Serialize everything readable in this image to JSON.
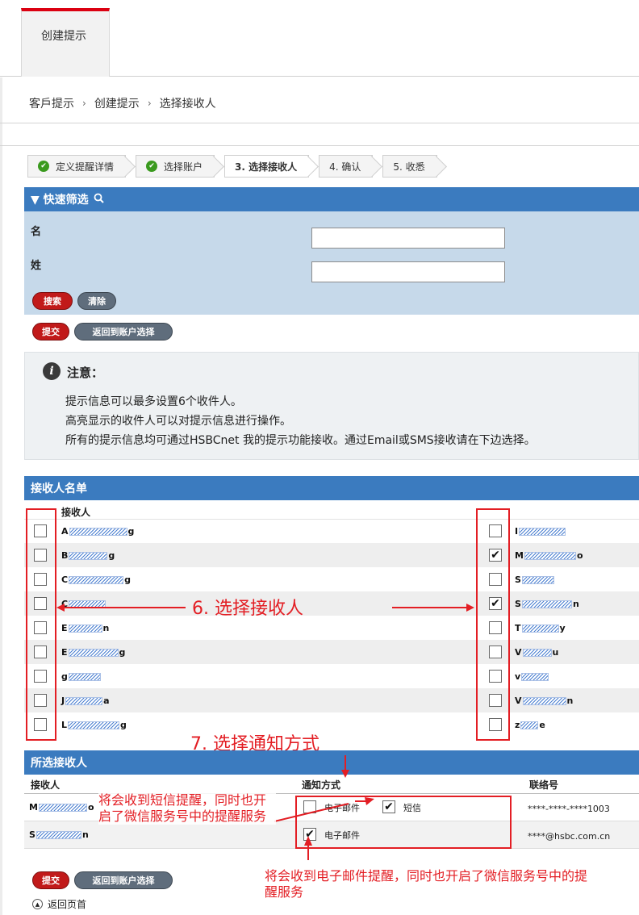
{
  "tab": {
    "label": "创建提示"
  },
  "breadcrumb": {
    "items": [
      "客戶提示",
      "创建提示",
      "选择接收人"
    ],
    "separator": "›"
  },
  "steps": [
    {
      "label": "定义提醒详情",
      "done": true
    },
    {
      "label": "选择账户",
      "done": true
    },
    {
      "label": "3. 选择接收人",
      "done": false,
      "active": true
    },
    {
      "label": "4. 确认",
      "done": false
    },
    {
      "label": "5. 收悉",
      "done": false
    }
  ],
  "quick_filter": {
    "title": "▼ 快速筛选",
    "first_name_label": "名",
    "last_name_label": "姓",
    "first_name_value": "",
    "last_name_value": "",
    "search_button": "搜索",
    "clear_button": "清除"
  },
  "actions": {
    "submit": "提交",
    "back_to_accounts": "返回到账户选择"
  },
  "notice": {
    "title": "注意：",
    "lines": [
      "提示信息可以最多设置6个收件人。",
      "高亮显示的收件人可以对提示信息进行操作。",
      "所有的提示信息均可通过HSBCnet 我的提示功能接收。通过Email或SMS接收请在下边选择。"
    ]
  },
  "recipients": {
    "title": "接收人名单",
    "column": "接收人",
    "left": [
      {
        "initial": "A",
        "tail": "g",
        "checked": false
      },
      {
        "initial": "B",
        "tail": "g",
        "checked": false
      },
      {
        "initial": "C",
        "tail": "g",
        "checked": false
      },
      {
        "initial": "C",
        "tail": "",
        "checked": false
      },
      {
        "initial": "E",
        "tail": "n",
        "checked": false
      },
      {
        "initial": "E",
        "tail": "g",
        "checked": false
      },
      {
        "initial": "g",
        "tail": "",
        "checked": false
      },
      {
        "initial": "J",
        "tail": "a",
        "checked": false
      },
      {
        "initial": "L",
        "tail": "g",
        "checked": false
      }
    ],
    "right": [
      {
        "initial": "I",
        "tail": "",
        "checked": false
      },
      {
        "initial": "M",
        "tail": "o",
        "checked": true
      },
      {
        "initial": "S",
        "tail": "",
        "checked": false
      },
      {
        "initial": "S",
        "tail": "n",
        "checked": true
      },
      {
        "initial": "T",
        "tail": "y",
        "checked": false
      },
      {
        "initial": "V",
        "tail": "u",
        "checked": false
      },
      {
        "initial": "v",
        "tail": "",
        "checked": false
      },
      {
        "initial": "V",
        "tail": "n",
        "checked": false
      },
      {
        "initial": "z",
        "tail": "e",
        "checked": false
      }
    ]
  },
  "selected": {
    "title": "所选接收人",
    "columns": [
      "接收人",
      "通知方式",
      "联络号"
    ],
    "rows": [
      {
        "initial": "M",
        "tail": "o",
        "email_checked": false,
        "email_label": "电子邮件",
        "sms_checked": true,
        "sms_label": "短信",
        "contact": "****-****-****1003"
      },
      {
        "initial": "S",
        "tail": "n",
        "email_checked": true,
        "email_label": "电子邮件",
        "contact": "****@hsbc.com.cn"
      }
    ]
  },
  "annotations": {
    "step6": "6. 选择接收人",
    "step7": "7. 选择通知方式",
    "sms_note": "将会收到短信提醒，同时也开启了微信服务号中的提醒服务",
    "email_note": "将会收到电子邮件提醒，同时也开启了微信服务号中的提醒服务"
  },
  "footer": {
    "back_to_top": "返回页首"
  },
  "colors": {
    "brand_red": "#db0011",
    "header_blue": "#3b7bbf",
    "filter_bg": "#c6d9ea",
    "annotation_red": "#e31e24"
  }
}
